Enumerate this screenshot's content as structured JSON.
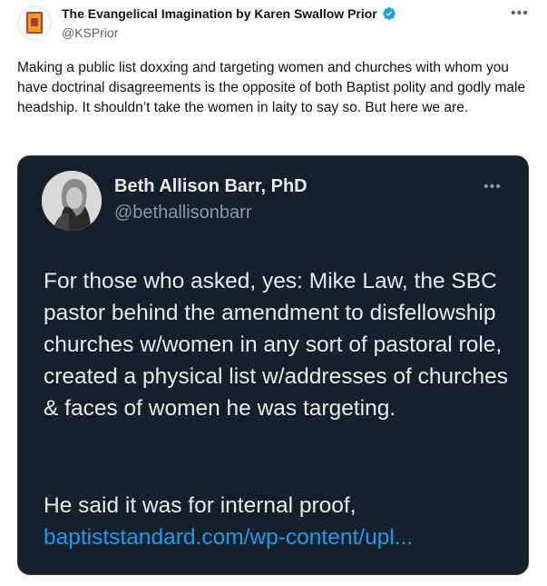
{
  "author": {
    "display_name": "The Evangelical Imagination by Karen Swallow Prior",
    "handle": "@KSPrior",
    "avatar_icon": "book-cover-icon",
    "verified": true
  },
  "tweet": {
    "text": "Making a public list doxxing and targeting women and churches with whom you have doctrinal disagreements is the opposite of both Baptist polity and godly male headship. It shouldn’t take the women in laity to say so. But here we are."
  },
  "quoted": {
    "display_name": "Beth Allison Barr, PhD",
    "handle": "@bethallisonbarr",
    "paragraph1": "For those who asked, yes: Mike Law, the SBC pastor behind the amendment to disfellowship churches w/women in any sort of pastoral role, created a physical list w/addresses of churches & faces of women he was targeting.",
    "paragraph2": "He said it was for internal proof,",
    "link": "baptiststandard.com/wp-content/upl..."
  },
  "colors": {
    "verified": "#1d9bf0",
    "link": "#1d9bf0",
    "quote_bg": "#15202b"
  }
}
